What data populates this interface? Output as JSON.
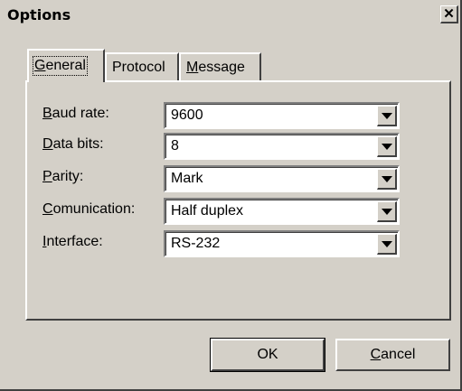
{
  "window": {
    "title": "Options",
    "close_glyph": "✕"
  },
  "tabs": [
    {
      "label": "General",
      "accel": "G",
      "rest": "eneral",
      "active": true
    },
    {
      "label": "Protocol",
      "accel": "",
      "rest": "Protocol",
      "active": false
    },
    {
      "label": "Message",
      "accel": "M",
      "rest": "essage",
      "active": false
    }
  ],
  "fields": [
    {
      "label": "Baud rate:",
      "accel": "B",
      "rest": "aud rate:",
      "value": "9600"
    },
    {
      "label": "Data bits:",
      "accel": "D",
      "rest": "ata bits:",
      "value": "8"
    },
    {
      "label": "Parity:",
      "accel": "P",
      "rest": "arity:",
      "value": "Mark"
    },
    {
      "label": "Comunication:",
      "accel": "C",
      "rest": "omunication:",
      "value": "Half duplex"
    },
    {
      "label": "Interface:",
      "accel": "I",
      "rest": "nterface:",
      "value": "RS-232"
    }
  ],
  "buttons": {
    "ok": {
      "label": "OK"
    },
    "cancel": {
      "label": "Cancel",
      "accel": "C",
      "rest": "ancel"
    }
  },
  "icons": {
    "close": "close-icon",
    "dropdown": "chevron-down-icon"
  }
}
